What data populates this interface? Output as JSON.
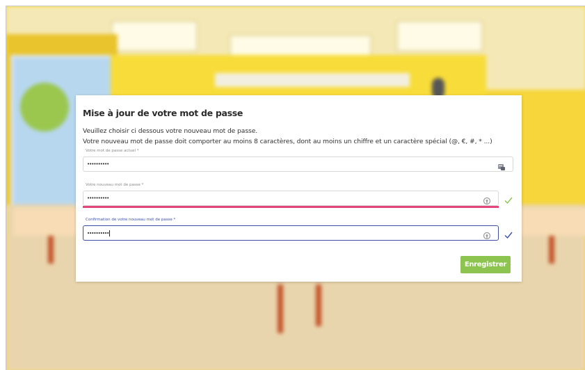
{
  "form": {
    "title": "Mise à jour de votre mot de passe",
    "intro_line1": "Veuillez choisir ci dessous votre nouveau mot de passe.",
    "intro_line2": "Votre nouveau mot de passe doit comporter au moins 8 caractères, dont au moins un chiffre et un caractère spécial (@, €, #, * ...)",
    "current_password": {
      "label": "Votre mot de passe actuel *",
      "value": "••••••••••"
    },
    "new_password": {
      "label": "Votre nouveau mot de passe *",
      "value": "••••••••••",
      "status": "valid"
    },
    "confirm_password": {
      "label": "Confirmation de votre nouveau mot de passe *",
      "value": "••••••••••",
      "status": "valid"
    },
    "save_label": "Enregistrer"
  },
  "colors": {
    "accent_green": "#8cc44f",
    "focus_blue": "#3a4ea6",
    "error_pink": "#e4457b",
    "check_green": "#8cc44f",
    "check_blue": "#3a4ea6"
  },
  "icons": {
    "current_password_icon": "password-manager-icon",
    "new_password_icon": "reveal-password-icon",
    "confirm_password_icon": "reveal-password-icon",
    "valid_icon": "checkmark-icon"
  }
}
